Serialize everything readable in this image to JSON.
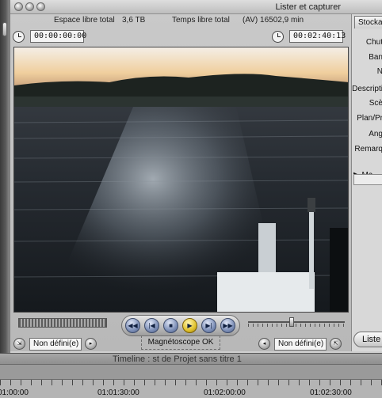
{
  "window": {
    "title": "Lister et capturer"
  },
  "info": {
    "free_space_label": "Espace libre total",
    "free_space_value": "3,6 TB",
    "free_time_label": "Temps libre total",
    "free_time_value": "(AV) 16502,9 min"
  },
  "timecodes": {
    "current": "00:00:00:00",
    "duration": "00:02:40:13"
  },
  "controls": {
    "in_point": "Non défini(e)",
    "out_point": "Non défini(e)",
    "vcr_status": "Magnétoscope OK"
  },
  "right_panel": {
    "tab_label": "Stocka",
    "fields": [
      "Chut",
      "Ban",
      "N",
      "Descripti",
      "Scè",
      "Plan/Pr",
      "Ang",
      "Remarq"
    ],
    "mark_label": "Ma",
    "list_button": "Liste"
  },
  "timeline": {
    "title": "Timeline : st de Projet sans titre 1",
    "ruler": [
      "01:00:00",
      "01:01:30:00",
      "01:02:00:00",
      "01:02:30:00"
    ]
  },
  "colors": {
    "play_button": "#e0c12c",
    "transport_button": "#7e90b8",
    "window_bg": "#cfcfcf"
  }
}
